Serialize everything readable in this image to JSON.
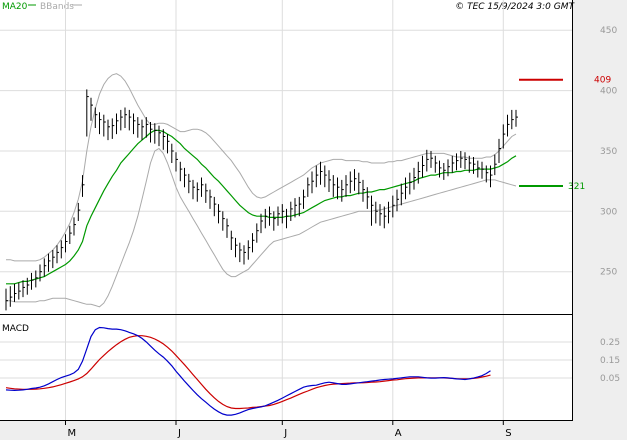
{
  "header": {
    "legend_ma": "MA20",
    "legend_bb": "BBands",
    "copyright": "© TEC 15/9/2024 3:0 GMT"
  },
  "colors": {
    "price": "#000000",
    "ma20": "#009900",
    "bbands": "#aaaaaa",
    "macd": "#0000cc",
    "signal": "#cc0000",
    "resistance": "#cc0000",
    "support": "#009900",
    "grid": "#dddddd",
    "axis_bg": "#eeeeee"
  },
  "chart_data": [
    {
      "type": "ohlc",
      "ylim": [
        215,
        475
      ],
      "y_ticks": [
        "450",
        "400",
        "350",
        "300",
        "250"
      ],
      "x_ticks": [
        "M",
        "J",
        "J",
        "A",
        "S"
      ],
      "x_tick_index": [
        14,
        40,
        65,
        91,
        117
      ],
      "resistance": {
        "value": 409,
        "label": "409"
      },
      "support": {
        "value": 321,
        "label": "321"
      },
      "close": [
        226,
        229,
        232,
        234,
        237,
        239,
        243,
        245,
        250,
        255,
        259,
        262,
        266,
        270,
        275,
        282,
        289,
        301,
        322,
        395,
        388,
        380,
        376,
        374,
        370,
        371,
        375,
        378,
        380,
        378,
        375,
        372,
        370,
        372,
        368,
        367,
        365,
        362,
        358,
        350,
        343,
        335,
        330,
        325,
        320,
        318,
        322,
        317,
        312,
        306,
        300,
        294,
        288,
        278,
        272,
        268,
        266,
        270,
        276,
        284,
        292,
        296,
        298,
        294,
        298,
        300,
        296,
        302,
        305,
        306,
        312,
        322,
        325,
        330,
        333,
        330,
        326,
        322,
        320,
        318,
        322,
        325,
        327,
        324,
        318,
        312,
        305,
        300,
        298,
        296,
        300,
        305,
        310,
        315,
        320,
        324,
        328,
        333,
        338,
        343,
        344,
        340,
        336,
        334,
        337,
        340,
        342,
        344,
        343,
        340,
        339,
        336,
        335,
        332,
        330,
        339,
        352,
        364,
        372,
        376,
        378
      ],
      "high": [
        236,
        238,
        240,
        241,
        243,
        245,
        249,
        251,
        256,
        261,
        265,
        268,
        272,
        276,
        281,
        288,
        295,
        307,
        330,
        401,
        394,
        386,
        382,
        380,
        376,
        377,
        381,
        384,
        386,
        384,
        381,
        378,
        376,
        378,
        374,
        373,
        371,
        368,
        364,
        356,
        349,
        341,
        336,
        331,
        326,
        324,
        328,
        323,
        318,
        312,
        306,
        300,
        294,
        284,
        278,
        274,
        272,
        276,
        282,
        290,
        298,
        302,
        304,
        300,
        304,
        306,
        302,
        308,
        311,
        312,
        318,
        328,
        333,
        338,
        341,
        338,
        334,
        330,
        328,
        326,
        330,
        333,
        335,
        332,
        326,
        320,
        313,
        308,
        306,
        304,
        308,
        313,
        318,
        323,
        328,
        332,
        336,
        341,
        346,
        351,
        350,
        346,
        342,
        340,
        343,
        346,
        348,
        350,
        349,
        346,
        345,
        342,
        341,
        338,
        338,
        347,
        360,
        372,
        380,
        384,
        384
      ],
      "low": [
        218,
        221,
        225,
        227,
        229,
        231,
        235,
        237,
        242,
        246,
        250,
        253,
        257,
        261,
        266,
        273,
        280,
        292,
        312,
        362,
        375,
        369,
        364,
        362,
        359,
        360,
        364,
        367,
        369,
        367,
        364,
        361,
        359,
        361,
        357,
        356,
        354,
        351,
        348,
        340,
        333,
        325,
        320,
        315,
        310,
        308,
        312,
        307,
        302,
        296,
        290,
        284,
        278,
        268,
        262,
        258,
        256,
        260,
        266,
        274,
        282,
        286,
        288,
        284,
        288,
        290,
        286,
        292,
        295,
        296,
        302,
        312,
        315,
        320,
        322,
        320,
        316,
        312,
        310,
        308,
        312,
        315,
        317,
        314,
        308,
        302,
        288,
        290,
        288,
        286,
        290,
        295,
        300,
        305,
        310,
        314,
        318,
        323,
        328,
        333,
        336,
        332,
        328,
        326,
        329,
        332,
        334,
        336,
        335,
        332,
        331,
        328,
        327,
        324,
        320,
        330,
        340,
        352,
        362,
        368,
        370
      ],
      "ma20": [
        240,
        240,
        240,
        241,
        242,
        242,
        243,
        244,
        245,
        246,
        248,
        250,
        252,
        254,
        256,
        259,
        263,
        268,
        275,
        288,
        296,
        303,
        310,
        317,
        323,
        329,
        334,
        340,
        344,
        348,
        352,
        356,
        359,
        362,
        365,
        367,
        367,
        366,
        364,
        362,
        359,
        356,
        352,
        349,
        346,
        343,
        339,
        336,
        332,
        328,
        325,
        321,
        317,
        313,
        309,
        305,
        302,
        299,
        297,
        296,
        296,
        296,
        295,
        295,
        295,
        295,
        296,
        296,
        297,
        298,
        299,
        301,
        303,
        305,
        307,
        309,
        310,
        311,
        312,
        312,
        313,
        313,
        314,
        315,
        315,
        316,
        316,
        317,
        318,
        318,
        319,
        320,
        321,
        322,
        323,
        324,
        325,
        327,
        328,
        329,
        330,
        330,
        331,
        332,
        332,
        332,
        333,
        333,
        334,
        334,
        334,
        335,
        335,
        335,
        335,
        336,
        337,
        339,
        341,
        344,
        346
      ],
      "bb_upper": [
        260,
        260,
        259,
        259,
        259,
        259,
        259,
        259,
        260,
        262,
        265,
        268,
        272,
        277,
        283,
        290,
        299,
        310,
        325,
        350,
        370,
        385,
        397,
        405,
        410,
        413,
        414,
        412,
        408,
        402,
        395,
        388,
        382,
        376,
        372,
        372,
        373,
        373,
        372,
        370,
        368,
        366,
        366,
        367,
        368,
        368,
        367,
        365,
        362,
        358,
        354,
        350,
        346,
        342,
        337,
        332,
        326,
        320,
        315,
        312,
        311,
        312,
        314,
        316,
        318,
        320,
        322,
        324,
        326,
        328,
        330,
        333,
        336,
        338,
        340,
        341,
        342,
        343,
        343,
        343,
        342,
        342,
        342,
        342,
        341,
        341,
        340,
        340,
        340,
        340,
        341,
        341,
        342,
        342,
        343,
        344,
        345,
        346,
        347,
        348,
        348,
        348,
        348,
        348,
        347,
        346,
        345,
        345,
        345,
        344,
        344,
        344,
        344,
        345,
        345,
        347,
        350,
        354,
        358,
        362,
        364
      ],
      "bb_lower": [
        226,
        226,
        225,
        225,
        225,
        225,
        225,
        225,
        226,
        226,
        227,
        228,
        228,
        228,
        228,
        227,
        226,
        225,
        224,
        223,
        223,
        222,
        221,
        224,
        230,
        238,
        247,
        256,
        265,
        274,
        284,
        296,
        310,
        325,
        340,
        350,
        352,
        348,
        340,
        330,
        320,
        312,
        306,
        300,
        294,
        288,
        282,
        276,
        270,
        264,
        258,
        252,
        248,
        246,
        246,
        248,
        250,
        252,
        256,
        260,
        264,
        268,
        272,
        275,
        276,
        277,
        278,
        279,
        280,
        281,
        283,
        285,
        287,
        289,
        291,
        292,
        293,
        294,
        295,
        296,
        297,
        298,
        299,
        300,
        300,
        300,
        300,
        301,
        301,
        302,
        303,
        304,
        305,
        306,
        307,
        308,
        309,
        310,
        311,
        312,
        313,
        314,
        315,
        316,
        317,
        318,
        319,
        320,
        321,
        322,
        323,
        324,
        325,
        326,
        326,
        326,
        325,
        324,
        323,
        322,
        321
      ]
    },
    {
      "type": "line",
      "title": "MACD",
      "ylim": [
        -1.2,
        2.6
      ],
      "y_ticks": [
        "0.25",
        "0.15",
        "0.05"
      ],
      "series": [
        {
          "values": [
            -0.1,
            -0.11,
            -0.12,
            -0.11,
            -0.1,
            -0.08,
            -0.05,
            -0.03,
            0.0,
            0.05,
            0.12,
            0.2,
            0.28,
            0.35,
            0.4,
            0.45,
            0.52,
            0.65,
            0.95,
            1.4,
            1.85,
            2.1,
            2.18,
            2.17,
            2.14,
            2.12,
            2.12,
            2.1,
            2.06,
            2.0,
            1.95,
            1.88,
            1.78,
            1.65,
            1.5,
            1.35,
            1.22,
            1.1,
            0.95,
            0.78,
            0.58,
            0.4,
            0.22,
            0.05,
            -0.12,
            -0.28,
            -0.42,
            -0.55,
            -0.68,
            -0.8,
            -0.9,
            -0.98,
            -1.02,
            -1.02,
            -0.99,
            -0.94,
            -0.88,
            -0.82,
            -0.78,
            -0.75,
            -0.72,
            -0.68,
            -0.62,
            -0.55,
            -0.48,
            -0.4,
            -0.32,
            -0.24,
            -0.16,
            -0.08,
            0.0,
            0.04,
            0.06,
            0.07,
            0.12,
            0.16,
            0.18,
            0.16,
            0.13,
            0.1,
            0.1,
            0.12,
            0.14,
            0.16,
            0.18,
            0.2,
            0.22,
            0.24,
            0.26,
            0.28,
            0.29,
            0.3,
            0.32,
            0.34,
            0.36,
            0.38,
            0.38,
            0.38,
            0.36,
            0.34,
            0.33,
            0.33,
            0.34,
            0.35,
            0.34,
            0.32,
            0.3,
            0.29,
            0.28,
            0.3,
            0.33,
            0.37,
            0.42,
            0.5,
            0.6
          ]
        },
        {
          "values": [
            -0.02,
            -0.04,
            -0.06,
            -0.07,
            -0.08,
            -0.08,
            -0.08,
            -0.07,
            -0.06,
            -0.04,
            -0.02,
            0.01,
            0.05,
            0.09,
            0.14,
            0.19,
            0.24,
            0.3,
            0.38,
            0.5,
            0.66,
            0.84,
            1.01,
            1.16,
            1.3,
            1.43,
            1.55,
            1.66,
            1.75,
            1.82,
            1.86,
            1.88,
            1.88,
            1.86,
            1.82,
            1.76,
            1.68,
            1.58,
            1.46,
            1.32,
            1.16,
            0.99,
            0.82,
            0.64,
            0.46,
            0.28,
            0.1,
            -0.08,
            -0.24,
            -0.39,
            -0.52,
            -0.63,
            -0.71,
            -0.76,
            -0.78,
            -0.78,
            -0.77,
            -0.76,
            -0.74,
            -0.73,
            -0.71,
            -0.69,
            -0.67,
            -0.63,
            -0.58,
            -0.52,
            -0.46,
            -0.4,
            -0.33,
            -0.26,
            -0.2,
            -0.14,
            -0.08,
            -0.02,
            0.02,
            0.06,
            0.09,
            0.11,
            0.12,
            0.13,
            0.14,
            0.15,
            0.16,
            0.16,
            0.16,
            0.17,
            0.18,
            0.19,
            0.2,
            0.22,
            0.24,
            0.26,
            0.27,
            0.29,
            0.31,
            0.32,
            0.33,
            0.34,
            0.34,
            0.34,
            0.34,
            0.34,
            0.34,
            0.34,
            0.33,
            0.32,
            0.31,
            0.3,
            0.3,
            0.31,
            0.32,
            0.34,
            0.37,
            0.4,
            0.44
          ]
        }
      ]
    }
  ]
}
